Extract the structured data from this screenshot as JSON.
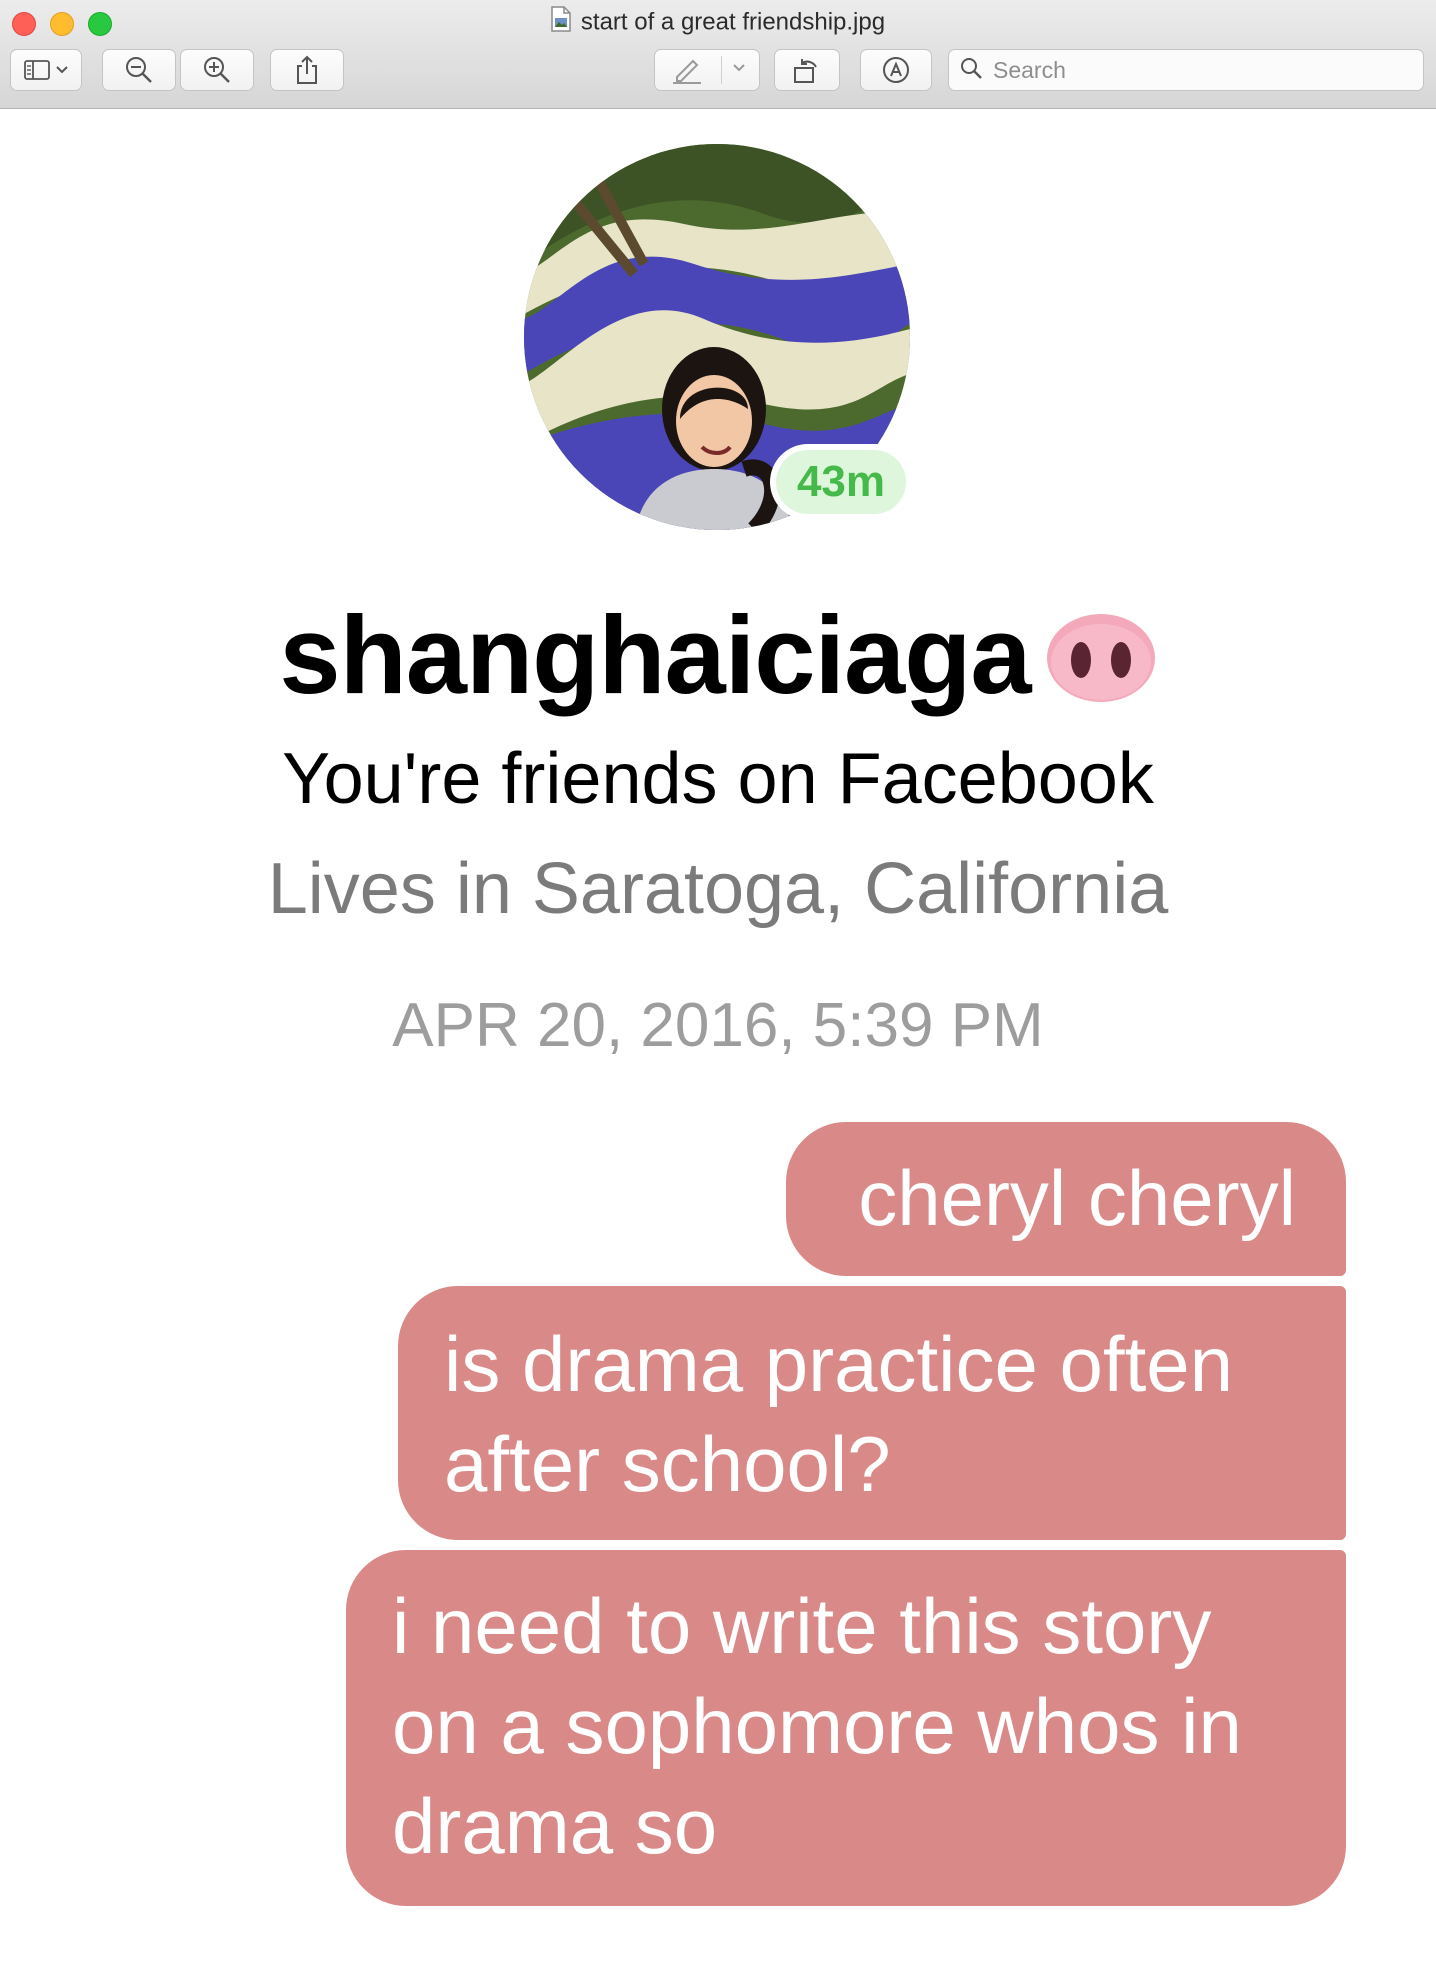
{
  "window": {
    "title": "start of a great friendship.jpg",
    "search_placeholder": "Search"
  },
  "toolbar": {
    "icons": [
      "sidebar-icon",
      "chevron-down-icon",
      "zoom-out-icon",
      "zoom-in-icon",
      "share-icon",
      "pen-icon",
      "chevron-down-icon",
      "rotate-icon",
      "markup-icon",
      "search-icon"
    ]
  },
  "profile": {
    "active_time": "43m",
    "name": "shanghaiciaga",
    "friend_status": "You're friends on Facebook",
    "location": "Lives in Saratoga, California"
  },
  "thread": {
    "timestamp": "APR 20, 2016, 5:39 PM",
    "messages": [
      {
        "lines": [
          "cheryl cheryl"
        ]
      },
      {
        "lines": [
          "is drama practice often",
          "after school?"
        ]
      },
      {
        "lines": [
          "i need to write this story",
          "on a sophomore whos in",
          "drama so"
        ]
      }
    ]
  },
  "colors": {
    "bubble": "#d98a88",
    "active_green": "#45b94a",
    "active_bg": "#def6dc"
  }
}
